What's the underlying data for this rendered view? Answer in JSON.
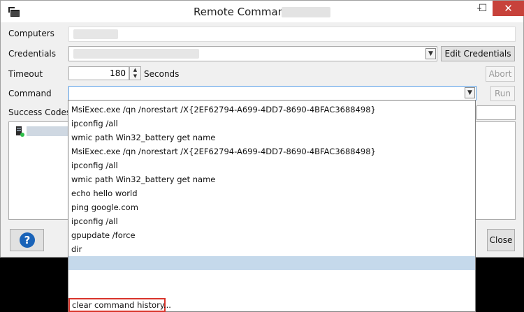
{
  "window": {
    "title": "Remote Command:",
    "controls": {
      "minimize": "–",
      "maximize": "☐",
      "close": "✕"
    }
  },
  "form": {
    "computers_label": "Computers",
    "credentials_label": "Credentials",
    "timeout_label": "Timeout",
    "timeout_value": "180",
    "timeout_unit": "Seconds",
    "command_label": "Command",
    "command_value": "",
    "success_codes_label": "Success Codes"
  },
  "buttons": {
    "edit_credentials": "Edit Credentials",
    "abort": "Abort",
    "run": "Run",
    "close": "Close",
    "help": "?"
  },
  "dropdown": {
    "items": [
      "MsiExec.exe /qn /norestart /X{2EF62794-A699-4DD7-8690-4BFAC3688498}",
      "ipconfig /all",
      "wmic path Win32_battery get name",
      "MsiExec.exe /qn /norestart /X{2EF62794-A699-4DD7-8690-4BFAC3688498}",
      "ipconfig /all",
      "wmic path Win32_battery get name",
      "echo hello world",
      "ping google.com",
      "ipconfig /all",
      "gpupdate /force",
      "dir",
      ""
    ],
    "selected_index": 11,
    "clear_history": "clear command history..."
  },
  "colors": {
    "close_button": "#c7423b",
    "selection": "#c5d9eb",
    "highlight_box": "#d9342b",
    "help_icon": "#1a63b8"
  }
}
